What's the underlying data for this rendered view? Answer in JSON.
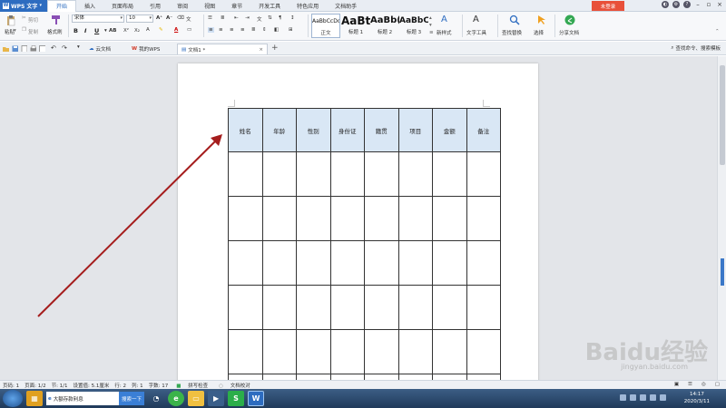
{
  "app": {
    "name": "WPS 文字",
    "login": "未登录"
  },
  "menu_tabs": [
    "开始",
    "插入",
    "页面布局",
    "引用",
    "审阅",
    "视图",
    "章节",
    "开发工具",
    "特色应用",
    "文档助手"
  ],
  "ribbon": {
    "paste": "粘贴",
    "cut": "剪切",
    "copy": "复制",
    "format_painter": "格式刷",
    "font_name": "宋体",
    "font_size": "10",
    "bold": "B",
    "italic": "I",
    "underline": "U",
    "styles": [
      {
        "sample": "AaBbCcDd",
        "label": "正文"
      },
      {
        "sample": "AaBt",
        "label": "标题 1"
      },
      {
        "sample": "AaBb(",
        "label": "标题 2"
      },
      {
        "sample": "AaBbC",
        "label": "标题 3"
      }
    ],
    "new_style": "新样式",
    "text_tools": "文字工具",
    "find_replace": "查找替换",
    "select": "选择",
    "share_doc": "分享文档"
  },
  "doc_tabs": [
    {
      "label": "云文档"
    },
    {
      "label": "我的WPS"
    },
    {
      "label": "文档1 *"
    }
  ],
  "search_cmd": "查找命令、搜索模板",
  "table": {
    "headers": [
      "姓名",
      "年龄",
      "性别",
      "身份证",
      "籍贯",
      "项目",
      "金额",
      "备注"
    ],
    "rows": 6
  },
  "status": {
    "items": [
      "页码: 1",
      "页面: 1/2",
      "节: 1/1",
      "设置值: 5.1厘米",
      "行: 2",
      "列: 1",
      "字数: 17",
      "拼写检查",
      "文档校对"
    ]
  },
  "taskbar": {
    "search_text": "大额存款利息",
    "search_btn": "搜索一下",
    "time": "14:17",
    "date": "2020/3/11"
  },
  "watermark": {
    "text": "Baidu经验",
    "sub": "jingyan.baidu.com"
  },
  "colors": {
    "accent": "#2d6cc0",
    "login": "#e8503a",
    "header_fill": "#d9e7f5",
    "arrow": "#a51d1d"
  }
}
